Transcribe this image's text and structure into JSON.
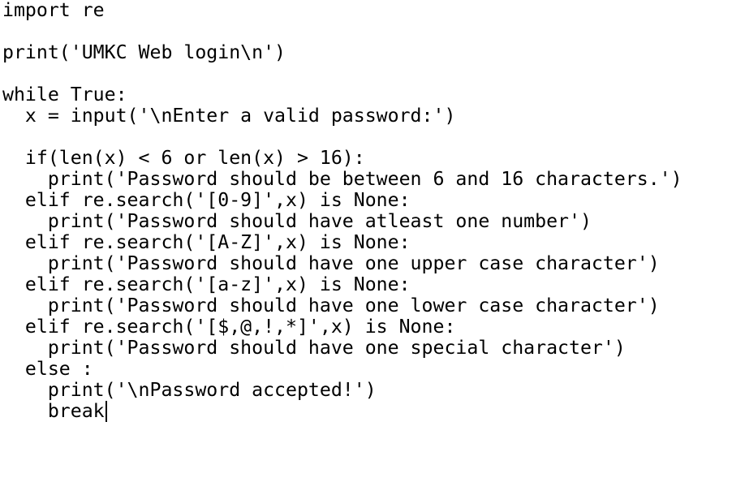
{
  "editor": {
    "lines": [
      "import re",
      "",
      "print('UMKC Web login\\n')",
      "",
      "while True:",
      "  x = input('\\nEnter a valid password:')",
      "",
      "  if(len(x) < 6 or len(x) > 16):",
      "    print('Password should be between 6 and 16 characters.')",
      "  elif re.search('[0-9]',x) is None:",
      "    print('Password should have atleast one number')",
      "  elif re.search('[A-Z]',x) is None:",
      "    print('Password should have one upper case character')",
      "  elif re.search('[a-z]',x) is None:",
      "    print('Password should have one lower case character')",
      "  elif re.search('[$,@,!,*]',x) is None:",
      "    print('Password should have one special character')",
      "  else :",
      "    print('\\nPassword accepted!')",
      "    break"
    ]
  }
}
